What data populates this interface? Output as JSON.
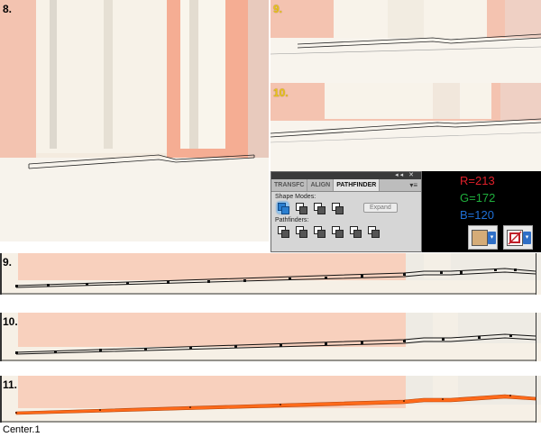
{
  "steps": {
    "s8": "8.",
    "s9_top": "9.",
    "s10_top": "10.",
    "s9": "9.",
    "s10": "10.",
    "s11": "11."
  },
  "pathfinder_panel": {
    "tabs": [
      "TRANSFC",
      "ALIGN",
      "PATHFINDER"
    ],
    "active_tab": "PATHFINDER",
    "shape_modes_label": "Shape Modes:",
    "pathfinders_label": "Pathfinders:",
    "expand_label": "Expand"
  },
  "color_panel": {
    "r_text": "R=213",
    "g_text": "G=172",
    "b_text": "B=120",
    "r_color": "#e0202a",
    "g_color": "#1fae3c",
    "b_color": "#1f6fd6",
    "fill_swatch": "#d5ac78"
  },
  "footer": "Center.1",
  "colors": {
    "orange_line": "#ff6a1a",
    "wall_orange": "#f6a58a",
    "cream": "#f6f0e2"
  }
}
